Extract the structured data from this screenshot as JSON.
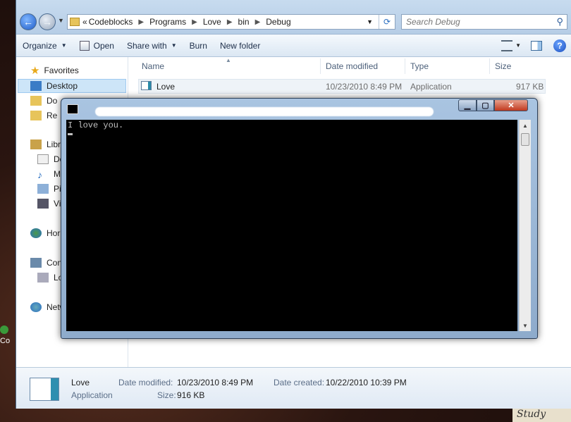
{
  "breadcrumbs": [
    "Codeblocks",
    "Programs",
    "Love",
    "bin",
    "Debug"
  ],
  "breadcrumb_overflow": "«",
  "search": {
    "placeholder": "Search Debug"
  },
  "toolbar": {
    "organize": "Organize",
    "open": "Open",
    "share_with": "Share with",
    "burn": "Burn",
    "new_folder": "New folder"
  },
  "nav": {
    "favorites": "Favorites",
    "desktop": "Desktop",
    "downloads": "Do",
    "recent": "Re",
    "libraries": "Libr",
    "documents": "Do",
    "music": "M",
    "pictures": "Pi",
    "videos": "Vi",
    "homegroup": "Hor",
    "computer": "Con",
    "local_disk": "Lo",
    "network": "Netw"
  },
  "columns": {
    "name": "Name",
    "date_modified": "Date modified",
    "type": "Type",
    "size": "Size"
  },
  "files": [
    {
      "name": "Love",
      "date_modified": "10/23/2010 8:49 PM",
      "type": "Application",
      "size": "917 KB"
    }
  ],
  "details": {
    "name": "Love",
    "type": "Application",
    "date_modified_label": "Date modified:",
    "date_modified": "10/23/2010 8:49 PM",
    "size_label": "Size:",
    "size": "916 KB",
    "date_created_label": "Date created:",
    "date_created": "10/22/2010 10:39 PM"
  },
  "console": {
    "output": "I love you."
  },
  "desktop": {
    "icon_label": "Co",
    "wallpaper_text": "Study"
  }
}
